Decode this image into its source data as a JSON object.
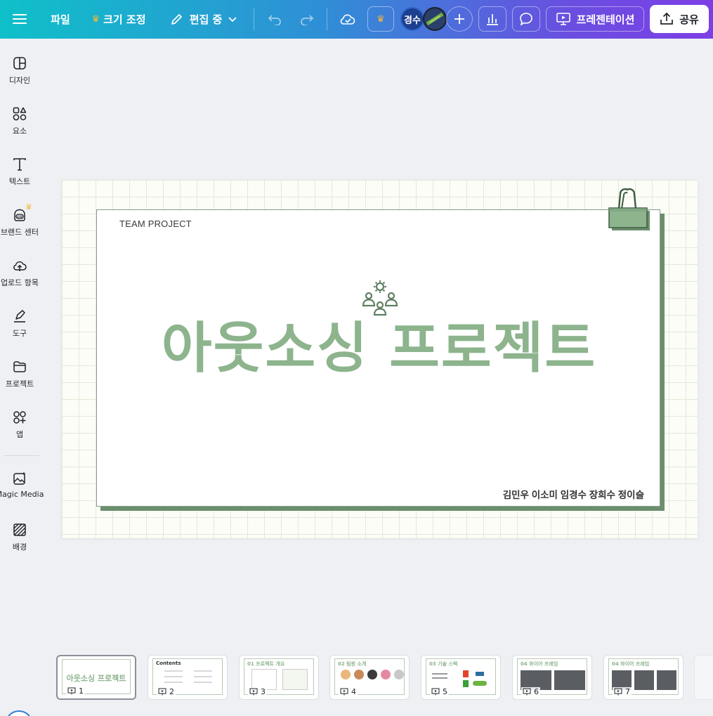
{
  "topbar": {
    "file_label": "파일",
    "resize_label": "크기 조정",
    "editing_label": "편집 중",
    "user_initials": "경수",
    "present_label": "프레젠테이션",
    "share_label": "공유"
  },
  "sidebar": {
    "items": [
      {
        "label": "디자인",
        "icon": "layout-icon"
      },
      {
        "label": "요소",
        "icon": "shapes-icon"
      },
      {
        "label": "텍스트",
        "icon": "text-icon"
      },
      {
        "label": "브랜드 센터",
        "icon": "brand-icon"
      },
      {
        "label": "업로드 항목",
        "icon": "cloud-upload-icon"
      },
      {
        "label": "도구",
        "icon": "pen-tool-icon"
      },
      {
        "label": "프로젝트",
        "icon": "folder-icon"
      },
      {
        "label": "앱",
        "icon": "apps-icon"
      },
      {
        "label": "Magic Media",
        "icon": "magic-media-icon"
      },
      {
        "label": "배경",
        "icon": "background-icon"
      }
    ]
  },
  "slide": {
    "team_label": "TEAM PROJECT",
    "title": "아웃소싱 프로젝트",
    "members": "김민우 이소미 임경수 장희수 정이슬"
  },
  "thumbnails": [
    {
      "number": "1",
      "title": "아웃소싱 프로젝트"
    },
    {
      "number": "2",
      "title": "Contents"
    },
    {
      "number": "3",
      "title": "01 프로젝트 개요"
    },
    {
      "number": "4",
      "title": "02 팀원 소개"
    },
    {
      "number": "5",
      "title": "03 기술 스택"
    },
    {
      "number": "6",
      "title": "04 와이어 프레임"
    },
    {
      "number": "7",
      "title": "04 와이어 프레임"
    }
  ],
  "colors": {
    "accent_green": "#8db48d",
    "dark_green": "#6b8f6d",
    "crown": "#f7b733"
  }
}
